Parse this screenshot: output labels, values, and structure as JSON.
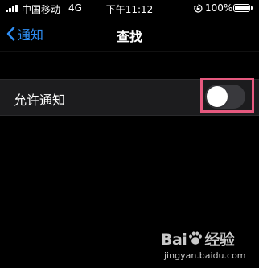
{
  "status_bar": {
    "carrier": "中国移动",
    "network": "4G",
    "time": "下午11:12",
    "battery_percent": "100%",
    "battery_level": 1.0,
    "icons": [
      "signal-icon",
      "rotation-lock-icon",
      "battery-icon"
    ]
  },
  "nav": {
    "back_label": "通知",
    "title": "查找"
  },
  "settings": {
    "allow_notifications_label": "允许通知",
    "allow_notifications_on": false
  },
  "colors": {
    "accent": "#2f8ff5",
    "highlight": "#e6597f",
    "toggle_off": "#39393d",
    "cell_background": "#1c1c1e"
  },
  "watermark": {
    "brand": "Bai经验",
    "brand_prefix": "Bai",
    "brand_suffix": "经验",
    "url": "jingyan.baidu.com"
  }
}
